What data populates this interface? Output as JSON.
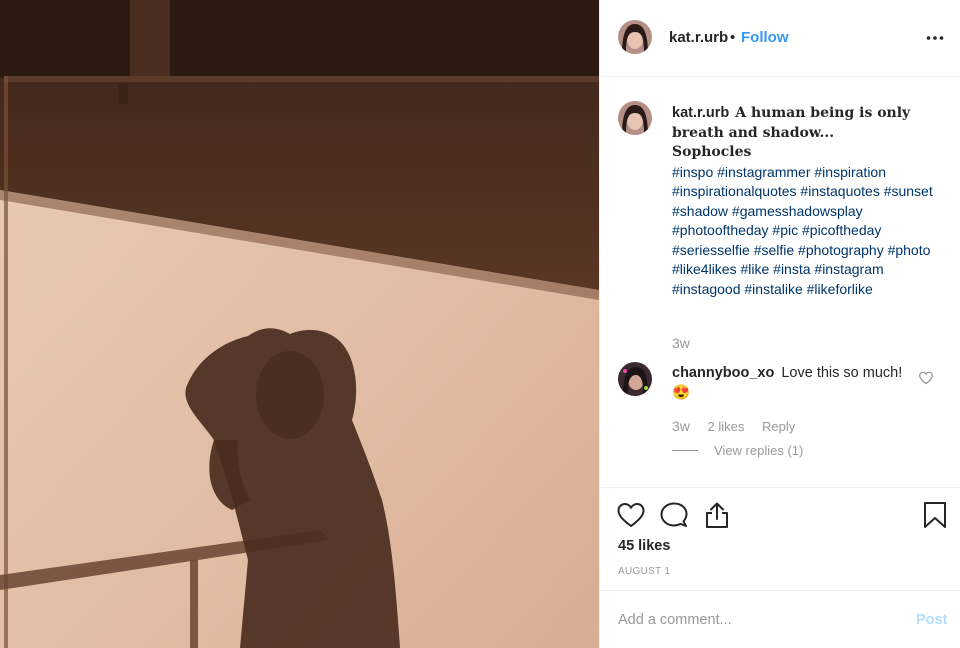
{
  "post": {
    "username": "kat.r.urb",
    "separator": "•",
    "follow_label": "Follow",
    "more_icon": "more-horizontal-icon",
    "photo_description_icon": "photo",
    "colors": {
      "link": "#3897f0",
      "hashtag": "#003569",
      "muted": "#999999",
      "post_disabled": "#b2dffc"
    }
  },
  "caption": {
    "username": "kat.r.urb",
    "quote": "A human being is only breath and shadow...",
    "author": "Sophocles",
    "hashtags": "#inspo #instagrammer #inspiration #inspirationalquotes #instaquotes #sunset #shadow #gamesshadowsplay #photooftheday #pic #picoftheday #seriesselfie #selfie #photography #photo #like4likes #like #insta #instagram #instagood #instalike #likeforlike",
    "time": "3w"
  },
  "comment": {
    "username": "channyboo_xo",
    "text": "Love this so much!",
    "emoji": "😍",
    "time": "3w",
    "likes": "2 likes",
    "reply_label": "Reply",
    "view_replies": "View replies (1)"
  },
  "actions": {
    "likes": "45 likes",
    "date": "AUGUST 1"
  },
  "add_comment": {
    "placeholder": "Add a comment...",
    "post_label": "Post"
  }
}
